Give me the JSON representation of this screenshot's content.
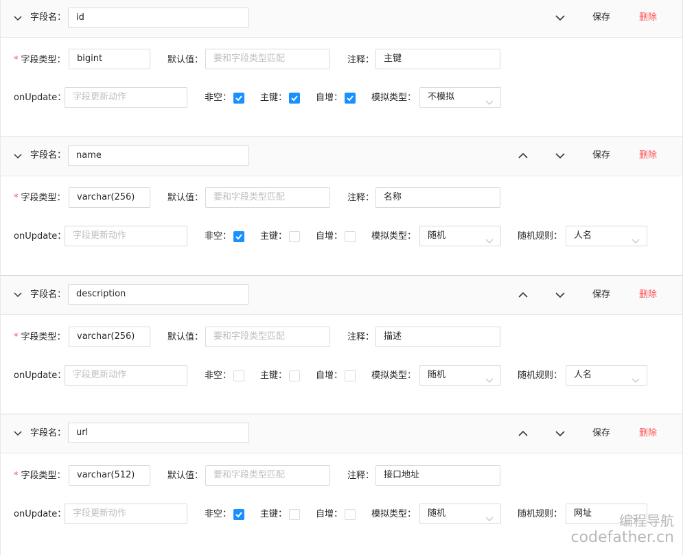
{
  "labels": {
    "field_name": "字段名：",
    "field_type": "字段类型：",
    "default_value": "默认值：",
    "comment": "注释：",
    "on_update": "onUpdate：",
    "not_null": "非空：",
    "primary_key": "主键：",
    "auto_increment": "自增：",
    "mock_type": "模拟类型：",
    "mock_rule": "随机规则：",
    "required_mark": "*",
    "save": "保存",
    "delete": "删除"
  },
  "placeholders": {
    "default_value": "要和字段类型匹配",
    "on_update": "字段更新动作"
  },
  "fields": [
    {
      "name": "id",
      "type": "bigint",
      "comment": "主键",
      "not_null": true,
      "primary_key": true,
      "auto_increment": true,
      "mock_type": "不模拟",
      "mock_rule": ""
    },
    {
      "name": "name",
      "type": "varchar(256)",
      "comment": "名称",
      "not_null": true,
      "primary_key": false,
      "auto_increment": false,
      "mock_type": "随机",
      "mock_rule": "人名"
    },
    {
      "name": "description",
      "type": "varchar(256)",
      "comment": "描述",
      "not_null": false,
      "primary_key": false,
      "auto_increment": false,
      "mock_type": "随机",
      "mock_rule": "人名"
    },
    {
      "name": "url",
      "type": "varchar(512)",
      "comment": "接口地址",
      "not_null": true,
      "primary_key": false,
      "auto_increment": false,
      "mock_type": "随机",
      "mock_rule": "网址"
    }
  ],
  "watermark": {
    "line1": "编程导航",
    "line2": "codefather.cn"
  },
  "colors": {
    "primary": "#1890ff",
    "danger": "#ff4d4f",
    "border": "#d9d9d9",
    "header_bg": "#fafafa"
  }
}
